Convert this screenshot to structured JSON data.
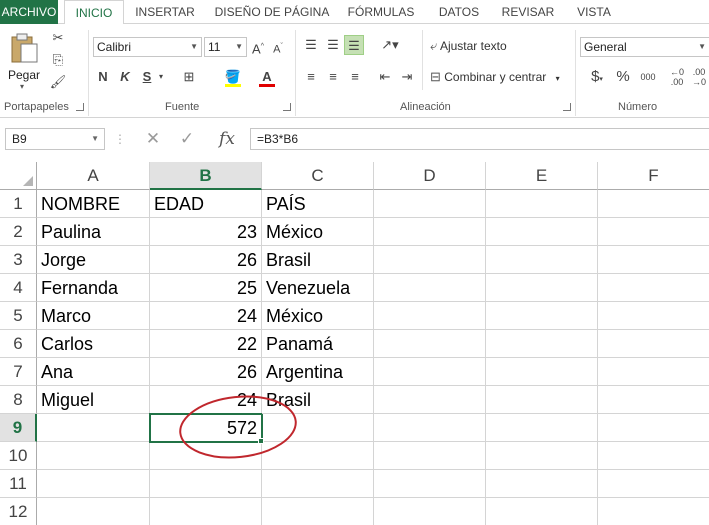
{
  "ribbon_tabs": [
    "ARCHIVO",
    "INICIO",
    "INSERTAR",
    "DISEÑO DE PÁGINA",
    "FÓRMULAS",
    "DATOS",
    "REVISAR",
    "VISTA"
  ],
  "clipboard": {
    "paste_label": "Pegar",
    "group_label": "Portapapeles"
  },
  "font": {
    "name": "Calibri",
    "size": "11",
    "bold": "N",
    "italic": "K",
    "underline": "S",
    "group_label": "Fuente"
  },
  "alignment": {
    "wrap_text": "Ajustar texto",
    "merge_center": "Combinar y centrar",
    "group_label": "Alineación"
  },
  "number": {
    "format": "General",
    "currency": "$",
    "percent": "%",
    "thousands": "000",
    "group_label": "Número"
  },
  "formula_bar": {
    "name_box": "B9",
    "fx_label": "fx",
    "formula": "=B3*B6"
  },
  "columns": [
    "A",
    "B",
    "C",
    "D",
    "E",
    "F"
  ],
  "rows": [
    "1",
    "2",
    "3",
    "4",
    "5",
    "6",
    "7",
    "8",
    "9",
    "10",
    "11",
    "12"
  ],
  "cells": {
    "A": [
      "NOMBRE",
      "Paulina",
      "Jorge",
      "Fernanda",
      "Marco",
      "Carlos",
      "Ana",
      "Miguel",
      "",
      "",
      "",
      ""
    ],
    "B": [
      "EDAD",
      "23",
      "26",
      "25",
      "24",
      "22",
      "26",
      "24",
      "572",
      "",
      "",
      ""
    ],
    "C": [
      "PAÍS",
      "México",
      "Brasil",
      "Venezuela",
      "México",
      "Panamá",
      "Argentina",
      "Brasil",
      "",
      "",
      "",
      ""
    ]
  },
  "colors": {
    "accent": "#217346",
    "annotation": "#c0272d"
  }
}
